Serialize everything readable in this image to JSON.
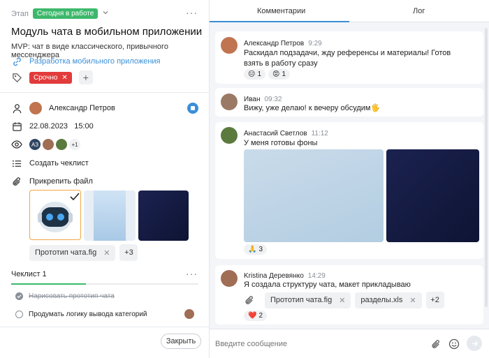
{
  "task": {
    "stage_label": "Этап",
    "stage_value": "Сегодня в работе",
    "title": "Модуль чата в мобильном приложении",
    "description": "MVP: чат в виде классического, привычного мессенджера",
    "link_text": "Разработка мобильного приложения",
    "tag": "Срочно",
    "assignee": "Александр Петров",
    "due": "22.08.2023   15:00",
    "watcher_initials": "АЗ",
    "watchers_more": "+1",
    "create_checklist": "Создать чеклист",
    "attach_file": "Прикрепить файл",
    "file_chip": "Прототип чата.fig",
    "files_more": "+3",
    "checklist_title": "Чеклист 1",
    "checklist_items": [
      {
        "text": "Нарисовать прототип чата",
        "done": true
      },
      {
        "text": "Продумать логику вывода категорий",
        "done": false
      }
    ],
    "close_button": "Закрыть"
  },
  "tabs": [
    "Комментарии",
    "Лог"
  ],
  "messages": [
    {
      "name": "Александр Петров",
      "time": "9:29",
      "text": "Раскидал подзадачи, жду референсы и материалы! Готов взять в работу сразу",
      "reactions": [
        {
          "emoji": "😑",
          "count": "1"
        },
        {
          "emoji": "😡",
          "count": "1"
        }
      ]
    },
    {
      "name": "Иван",
      "time": "09:32",
      "text": "Вижу, уже делаю! к вечеру обсудим🖐"
    },
    {
      "name": "Анастасий Светлов",
      "time": "11:12",
      "text": "У меня готовы фоны",
      "reactions": [
        {
          "emoji": "🙏",
          "count": "3"
        }
      ]
    },
    {
      "name": "Kristina Деревянко",
      "time": "14:29",
      "text": "Я создала структуру чата, макет прикладываю",
      "files": [
        "Прототип чата.fig",
        "разделы.xls"
      ],
      "files_more": "+2",
      "reactions": [
        {
          "emoji": "❤️",
          "count": "2"
        }
      ]
    }
  ],
  "input_placeholder": "Введите сообщение",
  "colors": {
    "accent": "#3a8fd8",
    "stage": "#3db86b",
    "tag": "#e23b3b"
  }
}
